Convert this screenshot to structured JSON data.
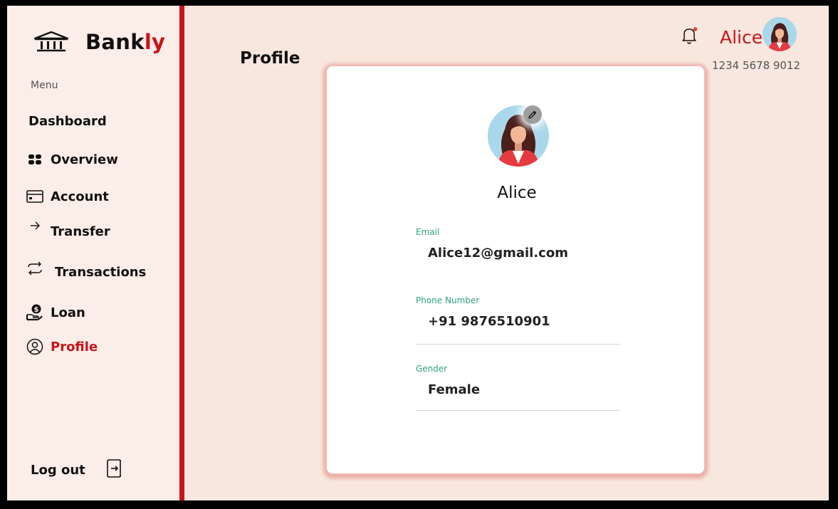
{
  "brand": {
    "name_main": "Bank",
    "name_accent": "ly",
    "icon": "bank-icon"
  },
  "sidebar": {
    "menu_label": "Menu",
    "items": [
      {
        "label": "Dashboard",
        "icon": ""
      },
      {
        "label": "Overview",
        "icon": "grid-icon"
      },
      {
        "label": "Account",
        "icon": "card-icon"
      },
      {
        "label": "Transfer",
        "icon": "arrow-right-icon"
      },
      {
        "label": "Transactions",
        "icon": "exchange-icon"
      },
      {
        "label": "Loan",
        "icon": "loan-icon"
      },
      {
        "label": "Profile",
        "icon": "user-circle-icon",
        "active": true
      }
    ],
    "logout_label": "Log out"
  },
  "header": {
    "page_title": "Profile",
    "user_name": "Alice",
    "account_number": "1234 5678 9012"
  },
  "profile": {
    "name": "Alice",
    "fields": [
      {
        "label": "Email",
        "value": "Alice12@gmail.com"
      },
      {
        "label": "Phone Number",
        "value": "+91 9876510901"
      },
      {
        "label": "Gender",
        "value": "Female"
      }
    ]
  },
  "colors": {
    "accent": "#c8141a",
    "background": "#f8e7de",
    "sidebar": "#fbede7",
    "field_label": "#2ea37a"
  }
}
